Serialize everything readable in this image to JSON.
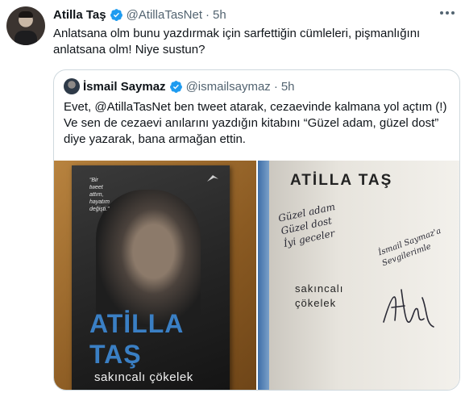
{
  "tweet": {
    "author_name": "Atilla Taş",
    "author_handle": "@AtillaTasNet",
    "separator": "·",
    "time": "5h",
    "text_line1": "Anlatsana olm bunu yazdırmak için sarfettiğin cümleleri, pişmanlığını",
    "text_line2": "anlatsana olm! Niye sustun?"
  },
  "quoted": {
    "author_name": "İsmail Saymaz",
    "author_handle": "@ismailsaymaz",
    "separator": "·",
    "time": "5h",
    "text_line1": "Evet, @AtillaTasNet ben tweet atarak, cezaevinde kalmana yol açtım (!)",
    "text_line2": "Ve sen de cezaevi anılarını yazdığın kitabını “Güzel adam, güzel dost”",
    "text_line3": "diye yazarak, bana armağan ettin."
  },
  "book_cover": {
    "tagline_1": "“Bir",
    "tagline_2": "tweet",
    "tagline_3": "attım,",
    "tagline_4": "hayatım",
    "tagline_5": "değişti.”",
    "author_line1": "ATİLLA",
    "author_line2": "TAŞ",
    "title": "sakıncalı çökelek"
  },
  "book_page": {
    "author": "ATİLLA TAŞ",
    "dedication_1": "Güzel adam",
    "dedication_2": "Güzel dost",
    "dedication_3": "İyi geceler",
    "recipient_1": "İsmail Saymaz'a",
    "recipient_2": "Sevgilerimle",
    "title_line1": "sakıncalı",
    "title_line2": "çökelek"
  },
  "icons": {
    "verified": "verified-badge-icon",
    "more": "more-options-icon"
  },
  "colors": {
    "verified_blue": "#1d9bf0",
    "secondary_text": "#536471",
    "border": "#cfd9de"
  }
}
